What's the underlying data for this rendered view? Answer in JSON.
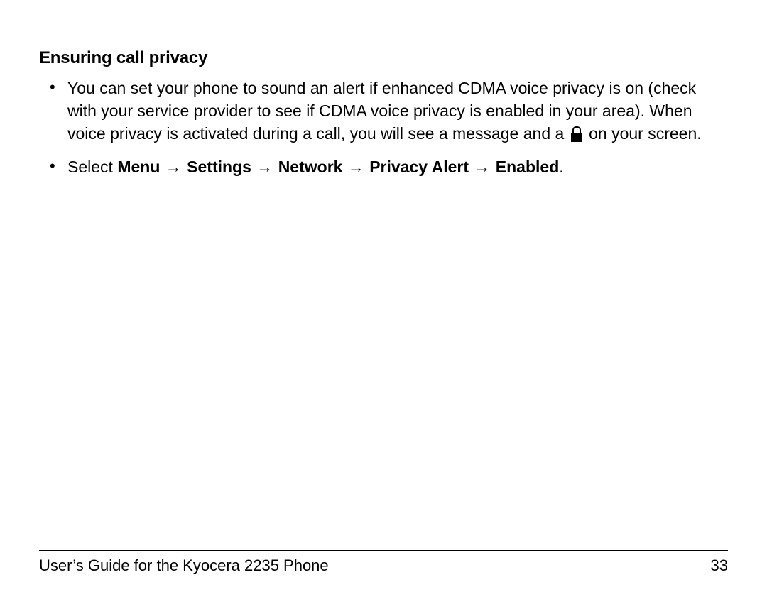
{
  "heading": "Ensuring call privacy",
  "bullet1": {
    "part_a": "You can set your phone to sound an alert if enhanced CDMA voice privacy is on (check with your service provider to see if CDMA voice privacy is enabled in your area). When voice privacy is activated during a call, you will see a message and a ",
    "part_b": " on your screen."
  },
  "bullet2": {
    "lead": "Select ",
    "nav": {
      "n1": "Menu",
      "n2": "Settings",
      "n3": "Network",
      "n4": "Privacy Alert",
      "n5": "Enabled"
    },
    "arrow": "→",
    "period": "."
  },
  "footer": {
    "left": "User’s Guide for the Kyocera 2235 Phone",
    "page": "33"
  }
}
